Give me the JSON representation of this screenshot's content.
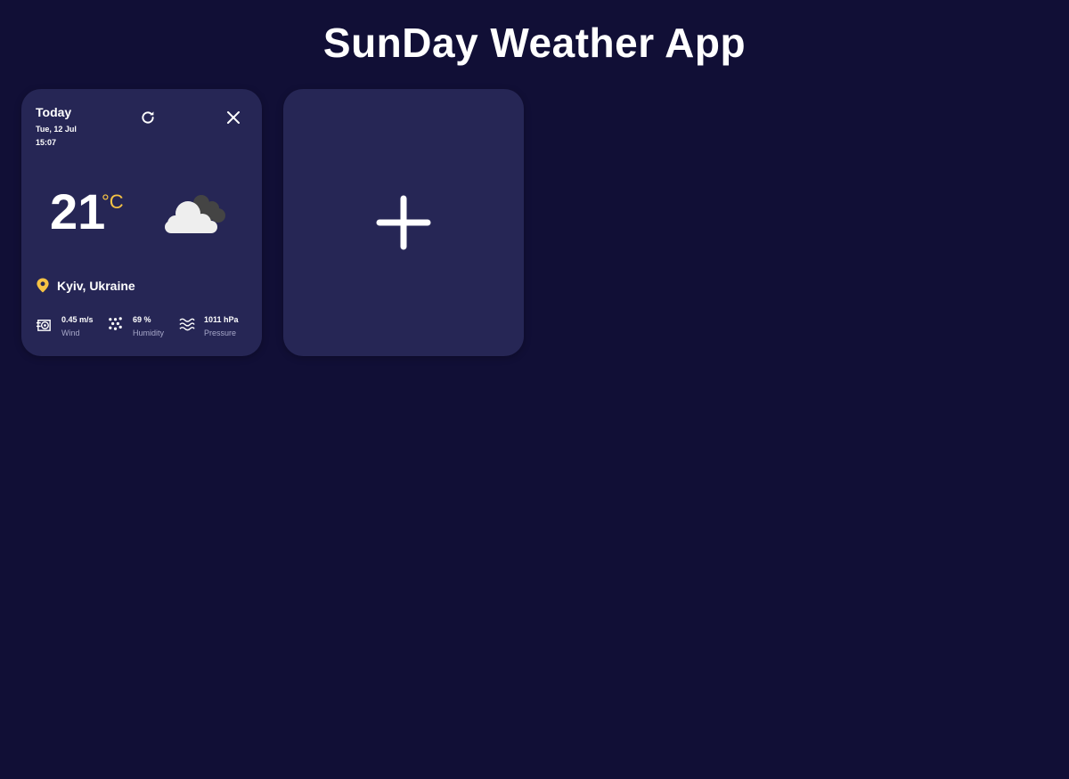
{
  "app": {
    "title": "SunDay Weather App"
  },
  "weather_card": {
    "day_label": "Today",
    "date": "Tue, 12 Jul",
    "time": "15:07",
    "temperature": "21",
    "unit": "°C",
    "condition_icon": "cloud-icon",
    "location": "Kyiv, Ukraine",
    "stats": {
      "wind": {
        "value": "0.45 m/s",
        "label": "Wind",
        "icon": "wind-icon"
      },
      "humidity": {
        "value": "69 %",
        "label": "Humidity",
        "icon": "humidity-icon"
      },
      "pressure": {
        "value": "1011 hPa",
        "label": "Pressure",
        "icon": "pressure-icon"
      }
    },
    "actions": {
      "refresh_icon": "refresh-icon",
      "close_icon": "close-icon"
    }
  },
  "add_card": {
    "icon": "plus-icon"
  },
  "colors": {
    "background": "#110f36",
    "card": "#262655",
    "accent": "#f6c344",
    "text": "#ffffff",
    "muted": "#a7a8c9"
  }
}
